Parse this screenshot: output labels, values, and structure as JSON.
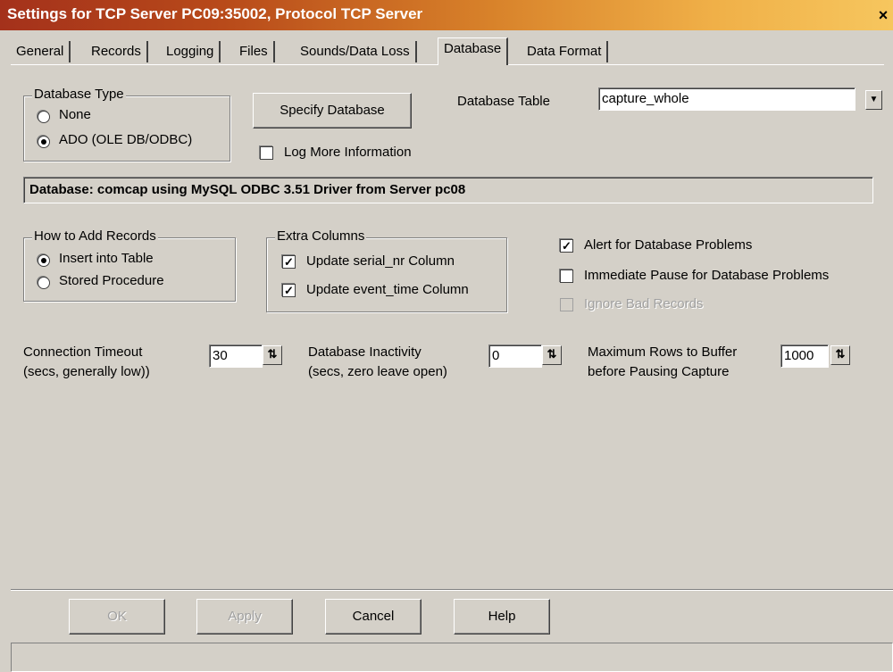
{
  "window": {
    "title": "Settings for TCP Server PC09:35002, Protocol TCP Server",
    "close_glyph": "×"
  },
  "tabs": [
    "General",
    "Records",
    "Logging",
    "Files",
    "Sounds/Data Loss",
    "Database",
    "Data Format"
  ],
  "active_tab": "Database",
  "database_type": {
    "title": "Database Type",
    "options": [
      "None",
      "ADO (OLE DB/ODBC)"
    ],
    "selected": "ADO (OLE DB/ODBC)"
  },
  "specify_database_label": "Specify Database",
  "database_table": {
    "label": "Database Table",
    "value": "capture_whole",
    "dropdown_glyph": "▼"
  },
  "log_more_information": {
    "label": "Log More Information",
    "checked": false
  },
  "database_info": "Database: comcap using MySQL ODBC 3.51 Driver from Server pc08",
  "how_to_add": {
    "title": "How to Add Records",
    "options": [
      "Insert into Table",
      "Stored Procedure"
    ],
    "selected": "Insert into Table"
  },
  "extra_columns": {
    "title": "Extra Columns",
    "items": [
      {
        "label": "Update serial_nr Column",
        "checked": true
      },
      {
        "label": "Update event_time Column",
        "checked": true
      }
    ]
  },
  "alerts": [
    {
      "label": "Alert for Database Problems",
      "checked": true,
      "enabled": true
    },
    {
      "label": "Immediate Pause for Database Problems",
      "checked": false,
      "enabled": true
    },
    {
      "label": "Ignore Bad Records",
      "checked": false,
      "enabled": false
    }
  ],
  "spinners": {
    "connection_timeout": {
      "line1": "Connection Timeout",
      "line2": "(secs, generally low))",
      "value": "30"
    },
    "database_inactivity": {
      "line1": "Database Inactivity",
      "line2": "(secs, zero leave open)",
      "value": "0"
    },
    "max_rows": {
      "line1": "Maximum Rows to Buffer",
      "line2": "before Pausing Capture",
      "value": "1000"
    }
  },
  "spin_glyph": "⇅",
  "check_glyph": "✓",
  "buttons": {
    "ok": "OK",
    "apply": "Apply",
    "cancel": "Cancel",
    "help": "Help"
  }
}
